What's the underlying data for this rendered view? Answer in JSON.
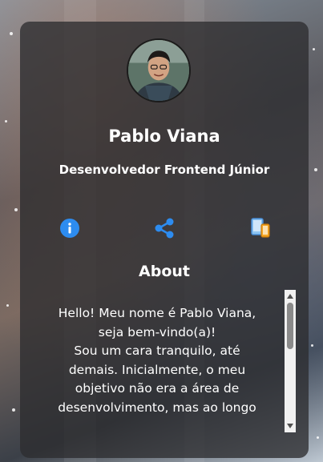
{
  "profile": {
    "name": "Pablo Viana",
    "role": "Desenvolvedor Frontend Júnior"
  },
  "tabs": [
    {
      "icon": "info-icon",
      "color": "#2d8cf0"
    },
    {
      "icon": "share-icon",
      "color": "#2d8cf0"
    },
    {
      "icon": "devices-icon",
      "color": "#5fa8e8"
    }
  ],
  "about": {
    "title": "About",
    "text": "Hello! Meu nome é Pablo Viana,\nseja bem-vindo(a)!\nSou um cara tranquilo, até\ndemais. Inicialmente, o meu\nobjetivo não era a área de\ndesenvolvimento, mas ao longo"
  },
  "colors": {
    "accent": "#2d8cf0",
    "card_background": "rgba(45,45,48,0.78)",
    "text": "#ffffff"
  }
}
